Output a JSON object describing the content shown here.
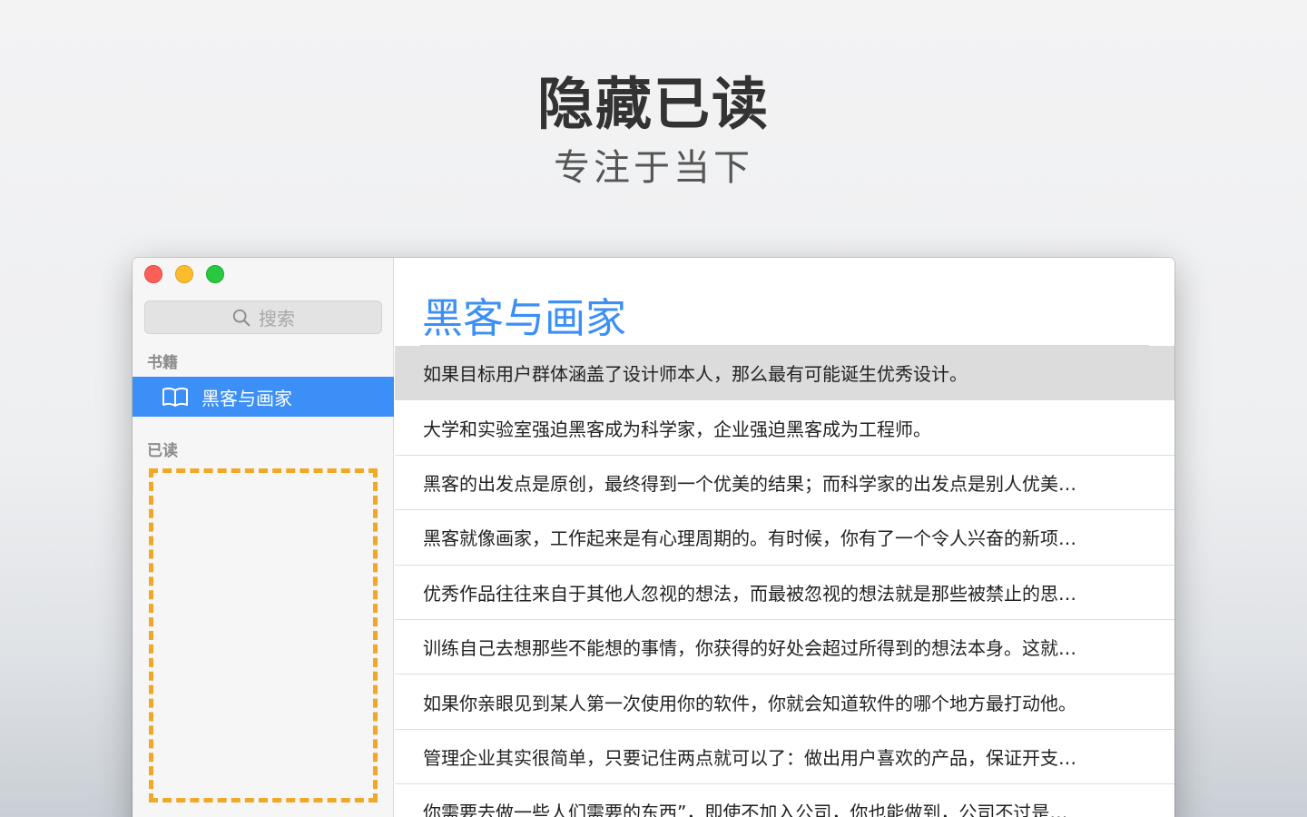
{
  "hero": {
    "title": "隐藏已读",
    "subtitle": "专注于当下"
  },
  "sidebar": {
    "search_placeholder": "搜索",
    "books_section_label": "书籍",
    "book_item_label": "黑客与画家",
    "read_section_label": "已读"
  },
  "content": {
    "title": "黑客与画家",
    "rows": [
      "如果目标用户群体涵盖了设计师本人，那么最有可能诞生优秀设计。",
      "大学和实验室强迫黑客成为科学家，企业强迫黑客成为工程师。",
      "黑客的出发点是原创，最终得到一个优美的结果；而科学家的出发点是别人优美…",
      "黑客就像画家，工作起来是有心理周期的。有时候，你有了一个令人兴奋的新项…",
      "优秀作品往往来自于其他人忽视的想法，而最被忽视的想法就是那些被禁止的思…",
      "训练自己去想那些不能想的事情，你获得的好处会超过所得到的想法本身。这就…",
      "如果你亲眼见到某人第一次使用你的软件，你就会知道软件的哪个地方最打动他。",
      "管理企业其实很简单，只要记住两点就可以了：做出用户喜欢的产品，保证开支…",
      "你需要去做一些人们需要的东西”，即使不加入公司，你也能做到，公司不过是…"
    ]
  },
  "colors": {
    "accent": "#3b8ff6",
    "dropzone": "#f0a826",
    "selected_row": "#dcdcdc"
  }
}
